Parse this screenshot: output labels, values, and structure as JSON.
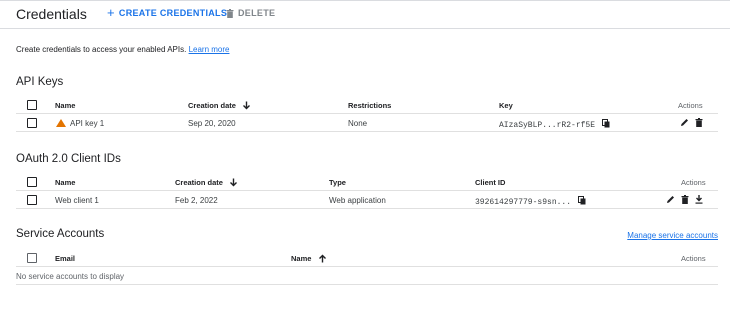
{
  "header": {
    "title": "Credentials",
    "create_label": "CREATE CREDENTIALS",
    "delete_label": "DELETE"
  },
  "intro": {
    "text": "Create credentials to access your enabled APIs.",
    "link": "Learn more"
  },
  "api_keys": {
    "title": "API Keys",
    "columns": {
      "name": "Name",
      "created": "Creation date",
      "restrictions": "Restrictions",
      "key": "Key",
      "actions": "Actions"
    },
    "rows": [
      {
        "name": "API key 1",
        "created": "Sep 20, 2020",
        "restrictions": "None",
        "key": "AIzaSyBLP...rR2-rf5E"
      }
    ]
  },
  "oauth": {
    "title": "OAuth 2.0 Client IDs",
    "columns": {
      "name": "Name",
      "created": "Creation date",
      "type": "Type",
      "client_id": "Client ID",
      "actions": "Actions"
    },
    "rows": [
      {
        "name": "Web client 1",
        "created": "Feb 2, 2022",
        "type": "Web application",
        "client_id": "392614297779-s9sn..."
      }
    ]
  },
  "service_accounts": {
    "title": "Service Accounts",
    "manage_link": "Manage service accounts",
    "columns": {
      "email": "Email",
      "name": "Name",
      "actions": "Actions"
    },
    "empty_text": "No service accounts to display"
  },
  "colors": {
    "accent": "#1a73e8",
    "warning": "#e37400",
    "divider": "#e0e0e0"
  }
}
